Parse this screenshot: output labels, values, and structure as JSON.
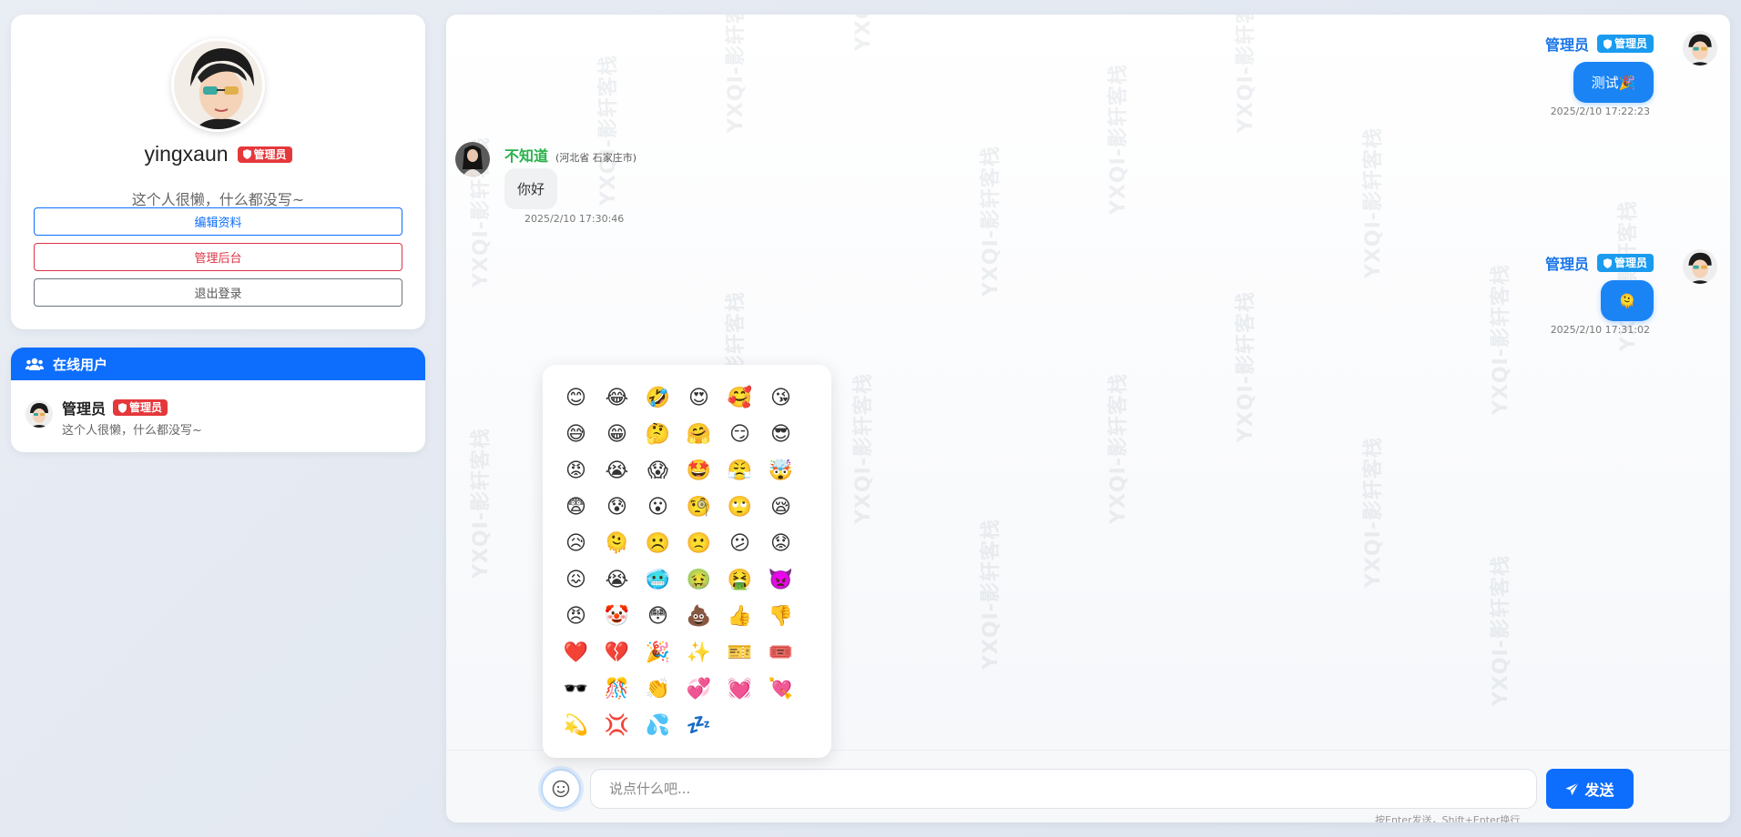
{
  "profile": {
    "username": "yingxaun",
    "role_badge": "管理员",
    "bio": "这个人很懒，什么都没写~",
    "buttons": {
      "edit": "编辑资料",
      "admin": "管理后台",
      "logout": "退出登录"
    }
  },
  "online_users": {
    "title": "在线用户",
    "users": [
      {
        "name": "管理员",
        "role_badge": "管理员",
        "bio": "这个人很懒，什么都没写~"
      }
    ]
  },
  "watermark": "YXQI-影轩客栈",
  "messages": [
    {
      "side": "right",
      "sender": "管理员",
      "badge": "管理员",
      "text": "测试🎉",
      "time": "2025/2/10 17:22:23"
    },
    {
      "side": "left",
      "sender": "不知道",
      "location": "(河北省 石家庄市)",
      "text": "你好",
      "time": "2025/2/10 17:30:46"
    },
    {
      "side": "right",
      "sender": "管理员",
      "badge": "管理员",
      "text": "🫠",
      "time": "2025/2/10 17:31:02"
    }
  ],
  "emoji_panel": {
    "emojis": [
      "😊",
      "😂",
      "🤣",
      "😍",
      "🥰",
      "😘",
      "😅",
      "😁",
      "🤔",
      "🤗",
      "😏",
      "😎",
      "😡",
      "😭",
      "😱",
      "🤩",
      "😤",
      "🤯",
      "😨",
      "😰",
      "😮",
      "🧐",
      "🙄",
      "😪",
      "😥",
      "🫠",
      "☹️",
      "🙁",
      "😕",
      "😟",
      "😖",
      "😭",
      "🥶",
      "🤢",
      "🤮",
      "👿",
      "😠",
      "🤡",
      "😳",
      "💩",
      "👍",
      "👎",
      "❤️",
      "💔",
      "🎉",
      "✨",
      "🎫",
      "🎟️",
      "🕶️",
      "🎊",
      "👏",
      "💞",
      "💓",
      "💘",
      "💫",
      "💢",
      "💦",
      "💤"
    ]
  },
  "input": {
    "placeholder": "说点什么吧...",
    "send_label": "发送",
    "hint": "按Enter发送，Shift+Enter换行"
  },
  "colors": {
    "primary": "#0d6efd",
    "danger": "#dc3545",
    "badge_red": "#e5383b",
    "badge_blue": "#1a9bf0",
    "bubble_blue": "#1a84f5",
    "sender_green": "#2ab24b"
  }
}
